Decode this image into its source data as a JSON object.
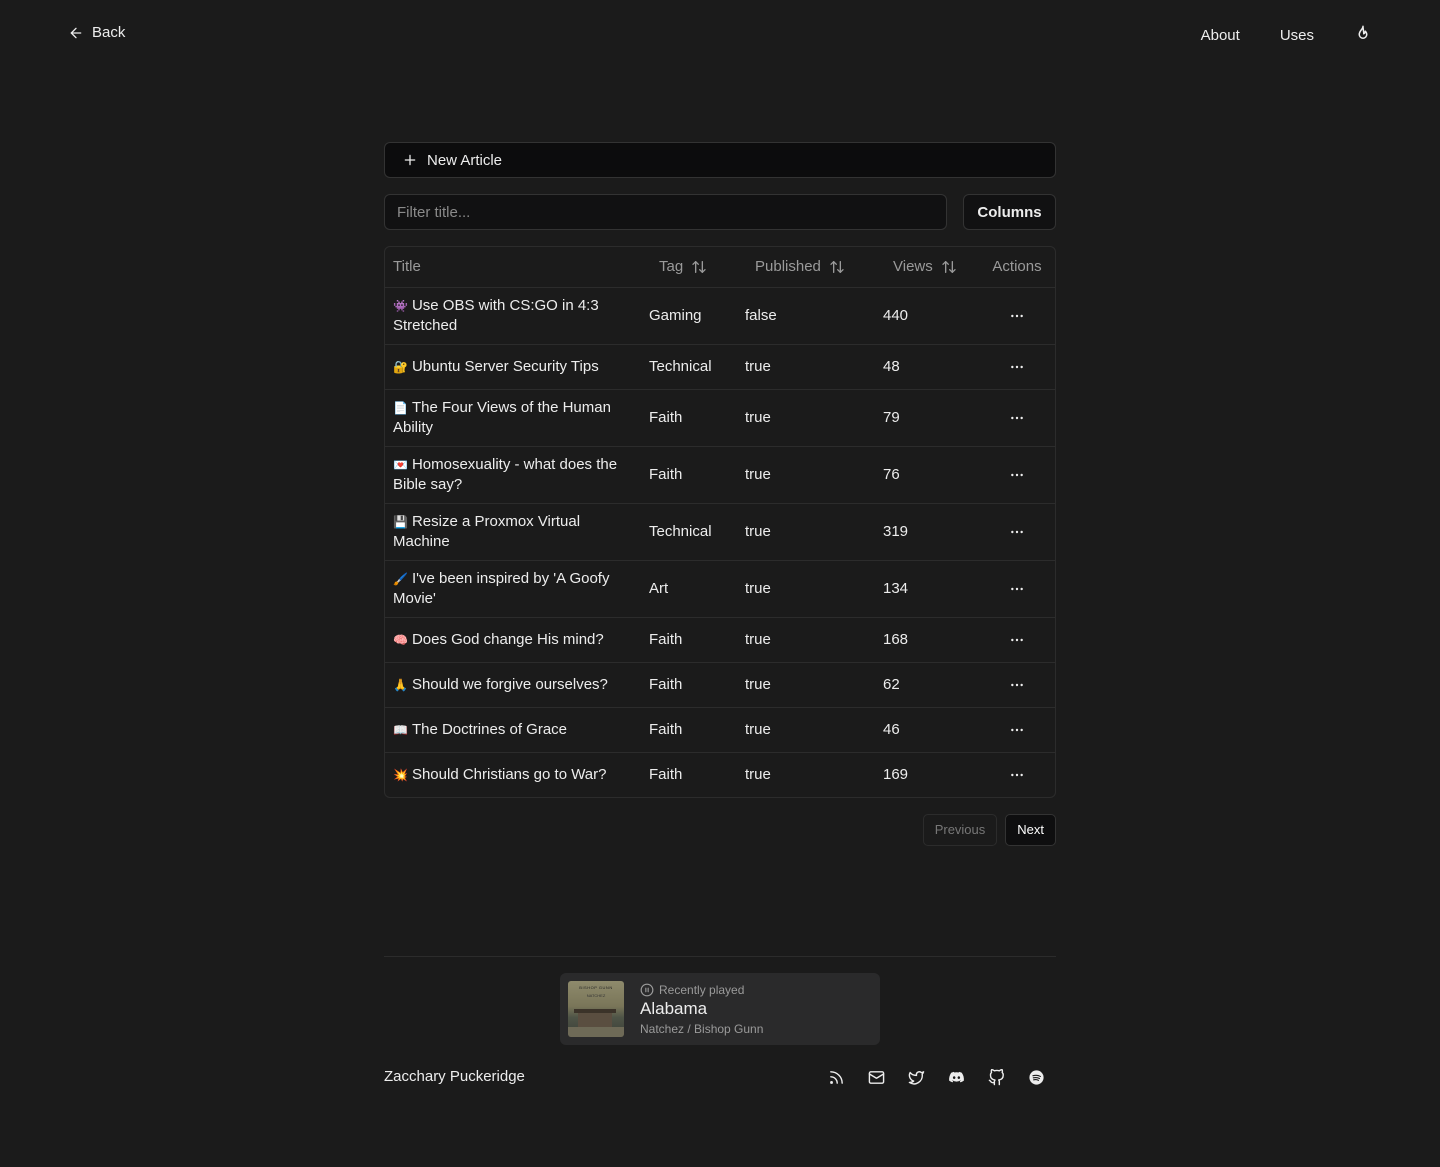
{
  "nav": {
    "back_label": "Back",
    "links": [
      "About",
      "Uses"
    ]
  },
  "toolbar": {
    "new_article_label": "New Article",
    "filter_placeholder": "Filter title...",
    "columns_label": "Columns"
  },
  "table": {
    "headers": {
      "title": "Title",
      "tag": "Tag",
      "published": "Published",
      "views": "Views",
      "actions": "Actions"
    },
    "rows": [
      {
        "emoji": "👾",
        "title": "Use OBS with CS:GO in 4:3 Stretched",
        "tag": "Gaming",
        "published": "false",
        "views": "440"
      },
      {
        "emoji": "🔐",
        "title": "Ubuntu Server Security Tips",
        "tag": "Technical",
        "published": "true",
        "views": "48"
      },
      {
        "emoji": "📄",
        "title": "The Four Views of the Human Ability",
        "tag": "Faith",
        "published": "true",
        "views": "79"
      },
      {
        "emoji": "💌",
        "title": "Homosexuality - what does the Bible say?",
        "tag": "Faith",
        "published": "true",
        "views": "76"
      },
      {
        "emoji": "💾",
        "title": "Resize a Proxmox Virtual Machine",
        "tag": "Technical",
        "published": "true",
        "views": "319"
      },
      {
        "emoji": "🖌️",
        "title": "I've been inspired by 'A Goofy Movie'",
        "tag": "Art",
        "published": "true",
        "views": "134"
      },
      {
        "emoji": "🧠",
        "title": "Does God change His mind?",
        "tag": "Faith",
        "published": "true",
        "views": "168"
      },
      {
        "emoji": "🙏",
        "title": "Should we forgive ourselves?",
        "tag": "Faith",
        "published": "true",
        "views": "62"
      },
      {
        "emoji": "📖",
        "title": "The Doctrines of Grace",
        "tag": "Faith",
        "published": "true",
        "views": "46"
      },
      {
        "emoji": "💥",
        "title": "Should Christians go to War?",
        "tag": "Faith",
        "published": "true",
        "views": "169"
      }
    ]
  },
  "pagination": {
    "previous_label": "Previous",
    "next_label": "Next"
  },
  "now_playing": {
    "label": "Recently played",
    "track": "Alabama",
    "artist": "Natchez / Bishop Gunn",
    "album_text": "BISHOP GUNN",
    "album_subtext": "NATCHEZ"
  },
  "footer": {
    "name": "Zacchary Puckeridge",
    "socials": [
      "rss-icon",
      "mail-icon",
      "twitter-icon",
      "discord-icon",
      "github-icon",
      "spotify-icon"
    ]
  }
}
